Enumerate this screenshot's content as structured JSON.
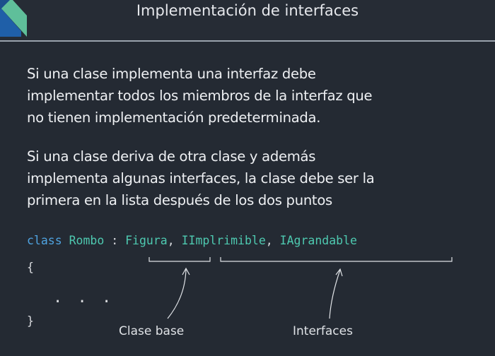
{
  "header": {
    "title": "Implementación de interfaces"
  },
  "content": {
    "paragraph1": [
      "Si una clase implementa una interfaz debe",
      "implementar todos los miembros de la interfaz que",
      "no tienen implementación predeterminada."
    ],
    "paragraph2": [
      "Si una clase deriva de otra clase y además",
      "implementa algunas interfaces, la clase debe ser la",
      "primera en la lista después de los dos puntos"
    ]
  },
  "code": {
    "keyword": "class",
    "class_name": "Rombo",
    "colon": ":",
    "base_class": "Figura",
    "comma1": ",",
    "interface1": "IImplrimible",
    "comma2": ",",
    "interface2": "IAgrandable",
    "open_brace": "{",
    "body": ". . .",
    "close_brace": "}"
  },
  "annotations": {
    "base_label": "Clase base",
    "interfaces_label": "Interfaces"
  },
  "colors": {
    "background": "#242a33",
    "keyword": "#4fa3e0",
    "type": "#4ec9b0",
    "text": "#eef0f3",
    "header_rule": "#9aa2ad",
    "logo_blue": "#1f5fa8",
    "logo_green": "#5fbf9a"
  }
}
